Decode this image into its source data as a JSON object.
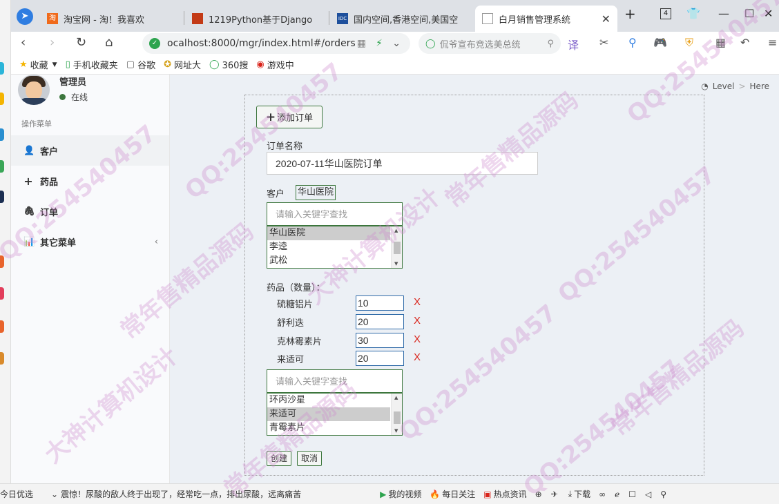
{
  "browser": {
    "tabs": [
      {
        "title": "淘宝网 - 淘！我喜欢",
        "favicon": "淘",
        "favicon_color": "#f06a1b"
      },
      {
        "title": "1219Python基于Django",
        "favicon": "",
        "favicon_color": "#c33a16"
      },
      {
        "title": "国内空间,香港空间,美国空",
        "favicon": "IDC",
        "favicon_color": "#1d4f9c"
      },
      {
        "title": "白月销售管理系统",
        "favicon": "",
        "favicon_color": "#888888"
      }
    ],
    "tab_count": "4",
    "address": "ocalhost:8000/mgr/index.html#/orders",
    "search_placeholder": "侃爷宣布竞选美总统",
    "bookmarks": [
      {
        "label": "收藏",
        "icon": "star-icon"
      },
      {
        "label": "手机收藏夹",
        "icon": "phone-icon"
      },
      {
        "label": "谷歌",
        "icon": "file-icon"
      },
      {
        "label": "网址大",
        "icon": "globe-icon"
      },
      {
        "label": "360搜",
        "icon": "search-icon"
      },
      {
        "label": "游戏中",
        "icon": "game-icon"
      }
    ]
  },
  "sidebar": {
    "user_name": "管理员",
    "user_status": "在线",
    "menu_header": "操作菜单",
    "items": [
      {
        "label": "客户",
        "icon": "user-icon"
      },
      {
        "label": "药品",
        "icon": "plus-icon"
      },
      {
        "label": "订单",
        "icon": "paperclip-icon"
      },
      {
        "label": "其它菜单",
        "icon": "bar-chart-icon"
      }
    ]
  },
  "breadcrumb": {
    "level": "Level",
    "here": "Here"
  },
  "form": {
    "add_button": "添加订单",
    "order_name_label": "订单名称",
    "order_name_value": "2020-07-11华山医院订单",
    "customer_label": "客户",
    "customer_selected": "华山医院",
    "customer_search_placeholder": "请输入关键字查找",
    "customer_options": [
      "华山医院",
      "李逵",
      "武松"
    ],
    "customer_selected_index": 0,
    "medicine_label": "药品（数量）：",
    "medicines": [
      {
        "name": "硫糖铝片",
        "qty": "10"
      },
      {
        "name": "舒利迭",
        "qty": "20"
      },
      {
        "name": "克林霉素片",
        "qty": "30"
      },
      {
        "name": "来适可",
        "qty": "20"
      }
    ],
    "delete_mark": "X",
    "medicine_search_placeholder": "请输入关键字查找",
    "medicine_options": [
      "环丙沙星",
      "来适可",
      "青霉素片"
    ],
    "medicine_selected_index": 1,
    "create_button": "创建",
    "cancel_button": "取消"
  },
  "statusbar": {
    "left": "今日优选",
    "news": "震惊！尿酸的敌人终于出现了，经常吃一点，排出尿酸，远离痛苦",
    "items": [
      "我的视频",
      "每日关注",
      "热点资讯",
      "下载"
    ]
  },
  "watermark": [
    "QQ:254540457",
    "常年售精品源码",
    "大神计算机设计"
  ]
}
